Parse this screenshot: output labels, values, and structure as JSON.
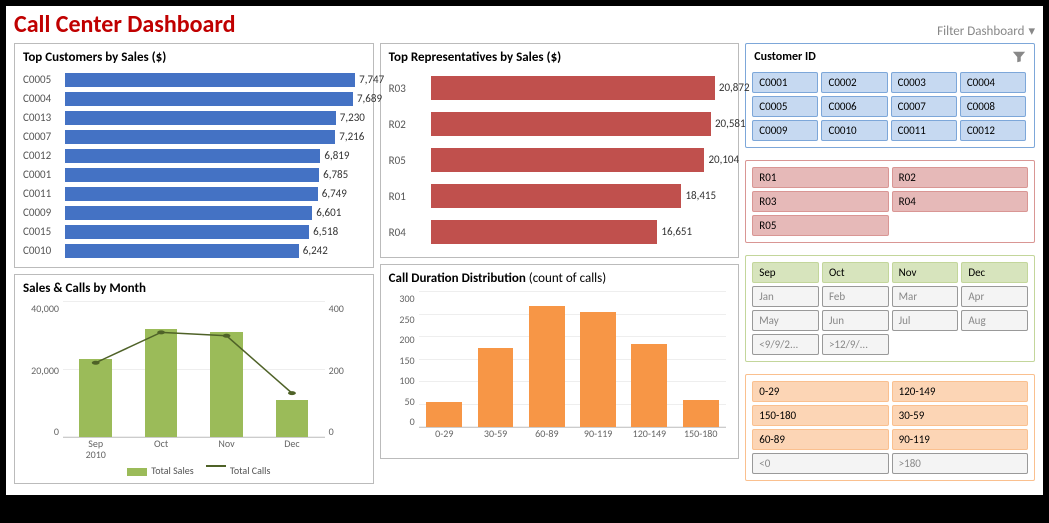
{
  "header": {
    "title": "Call Center Dashboard",
    "filter_label": "Filter Dashboard"
  },
  "panels": {
    "top_customers": {
      "title": "Top Customers by Sales ($)"
    },
    "top_reps": {
      "title": "Top Representatives by Sales ($)"
    },
    "sales_calls": {
      "title": "Sales & Calls by Month"
    },
    "duration": {
      "title_main": "Call Duration Distribution",
      "title_sub": " (count of calls)"
    }
  },
  "slicers": {
    "customer": {
      "title": "Customer ID"
    }
  },
  "legend": {
    "sales": "Total Sales",
    "calls": "Total Calls"
  },
  "chart_data": [
    {
      "id": "top_customers",
      "type": "bar",
      "orientation": "horizontal",
      "color": "#4472c4",
      "categories": [
        "C0005",
        "C0004",
        "C0013",
        "C0007",
        "C0012",
        "C0001",
        "C0011",
        "C0009",
        "C0015",
        "C0010"
      ],
      "values": [
        7747,
        7689,
        7230,
        7216,
        6819,
        6785,
        6749,
        6601,
        6518,
        6242
      ],
      "xlim": [
        0,
        8000
      ]
    },
    {
      "id": "top_reps",
      "type": "bar",
      "orientation": "horizontal",
      "color": "#c0504d",
      "categories": [
        "R03",
        "R02",
        "R05",
        "R01",
        "R04"
      ],
      "values": [
        20872,
        20581,
        20104,
        18415,
        16651
      ],
      "xlim": [
        0,
        22000
      ]
    },
    {
      "id": "sales_calls",
      "type": "combo",
      "categories": [
        "Sep",
        "Oct",
        "Nov",
        "Dec"
      ],
      "x_sublabel": "2010",
      "series": [
        {
          "name": "Total Sales",
          "type": "bar",
          "axis": "left",
          "color": "#9bbb59",
          "values": [
            23000,
            32000,
            31000,
            11000
          ]
        },
        {
          "name": "Total Calls",
          "type": "line",
          "axis": "right",
          "color": "#4f6228",
          "values": [
            220,
            310,
            300,
            130
          ]
        }
      ],
      "ylim_left": [
        0,
        40000
      ],
      "ylim_right": [
        0,
        400
      ],
      "yticks_left": [
        0,
        20000,
        40000
      ],
      "yticks_right": [
        0,
        200,
        400
      ]
    },
    {
      "id": "duration",
      "type": "bar",
      "orientation": "vertical",
      "color": "#f79646",
      "categories": [
        "0-29",
        "30-59",
        "60-89",
        "90-119",
        "120-149",
        "150-180"
      ],
      "values": [
        55,
        175,
        270,
        255,
        185,
        60
      ],
      "ylim": [
        0,
        300
      ],
      "yticks": [
        0,
        50,
        100,
        150,
        200,
        250,
        300
      ]
    }
  ],
  "filters": {
    "customers": {
      "items": [
        "C0001",
        "C0002",
        "C0003",
        "C0004",
        "C0005",
        "C0006",
        "C0007",
        "C0008",
        "C0009",
        "C0010",
        "C0011",
        "C0012"
      ],
      "active": [
        "C0001",
        "C0002",
        "C0003",
        "C0004",
        "C0005",
        "C0006",
        "C0007",
        "C0008",
        "C0009",
        "C0010",
        "C0011",
        "C0012"
      ]
    },
    "reps": {
      "items": [
        "R01",
        "R02",
        "R03",
        "R04",
        "R05"
      ],
      "active": [
        "R01",
        "R02",
        "R03",
        "R04",
        "R05"
      ]
    },
    "months": {
      "items": [
        "Sep",
        "Oct",
        "Nov",
        "Dec",
        "Jan",
        "Feb",
        "Mar",
        "Apr",
        "May",
        "Jun",
        "Jul",
        "Aug",
        "<9/9/2...",
        ">12/9/..."
      ],
      "active": [
        "Sep",
        "Oct",
        "Nov",
        "Dec"
      ]
    },
    "duration": {
      "items": [
        "0-29",
        "120-149",
        "150-180",
        "30-59",
        "60-89",
        "90-119",
        "<0",
        ">180"
      ],
      "active": [
        "0-29",
        "120-149",
        "150-180",
        "30-59",
        "60-89",
        "90-119"
      ]
    }
  }
}
